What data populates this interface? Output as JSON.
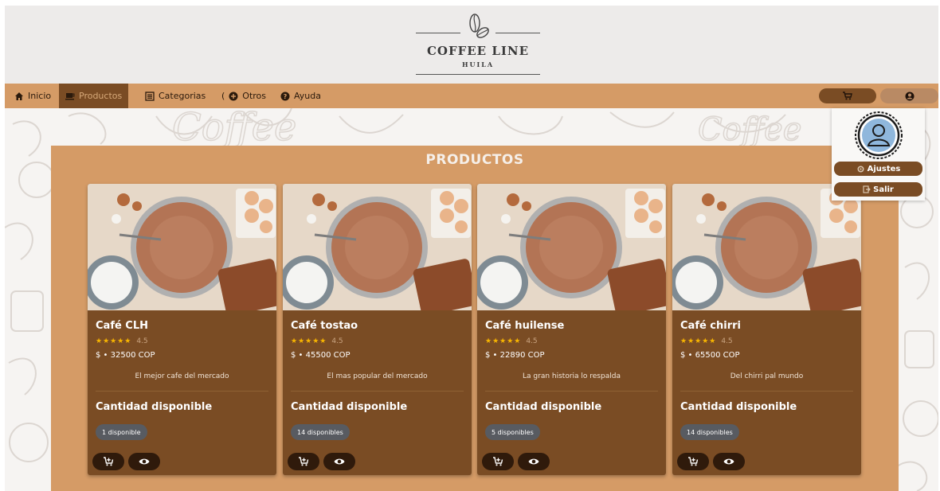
{
  "brand": {
    "title": "COFFEE LINE",
    "subtitle": "HUILA"
  },
  "nav": {
    "items": [
      {
        "label": "Inicio",
        "icon": "home-icon"
      },
      {
        "label": "Productos",
        "icon": "coffee-cup-icon",
        "active": true
      },
      {
        "label": "Categorias",
        "icon": "list-icon"
      },
      {
        "label": "Otros",
        "icon": "plus-circle-icon"
      },
      {
        "label": "Ayuda",
        "icon": "help-circle-icon"
      }
    ],
    "cart_icon": "cart-icon",
    "user_icon": "user-circle-icon"
  },
  "products_panel": {
    "title": "PRODUCTOS"
  },
  "products": [
    {
      "name": "Café CLH",
      "stars": "★★★★★",
      "rating": "4.5",
      "price": "$ • 32500 COP",
      "description": "El mejor cafe del mercado",
      "qty_label": "Cantidad disponible",
      "availability": "1 disponible"
    },
    {
      "name": "Café tostao",
      "stars": "★★★★★",
      "rating": "4.5",
      "price": "$ • 45500 COP",
      "description": "El mas popular del mercado",
      "qty_label": "Cantidad disponible",
      "availability": "14 disponibles"
    },
    {
      "name": "Café huilense",
      "stars": "★★★★★",
      "rating": "4.5",
      "price": "$ • 22890 COP",
      "description": "La gran historia lo respalda",
      "qty_label": "Cantidad disponible",
      "availability": "5 disponibles"
    },
    {
      "name": "Café chirri",
      "stars": "★★★★★",
      "rating": "4.5",
      "price": "$ • 65500 COP",
      "description": "Del chirri pal mundo",
      "qty_label": "Cantidad disponible",
      "availability": "14 disponibles"
    }
  ],
  "user_menu": {
    "settings_label": "Ajustes",
    "logout_label": "Salir"
  },
  "colors": {
    "header_bg": "#edebea",
    "nav_bg": "#d59b66",
    "accent_brown": "#7a4c24",
    "dark_button": "#2f1a0b",
    "star": "#f7b500",
    "badge": "#585b61"
  }
}
